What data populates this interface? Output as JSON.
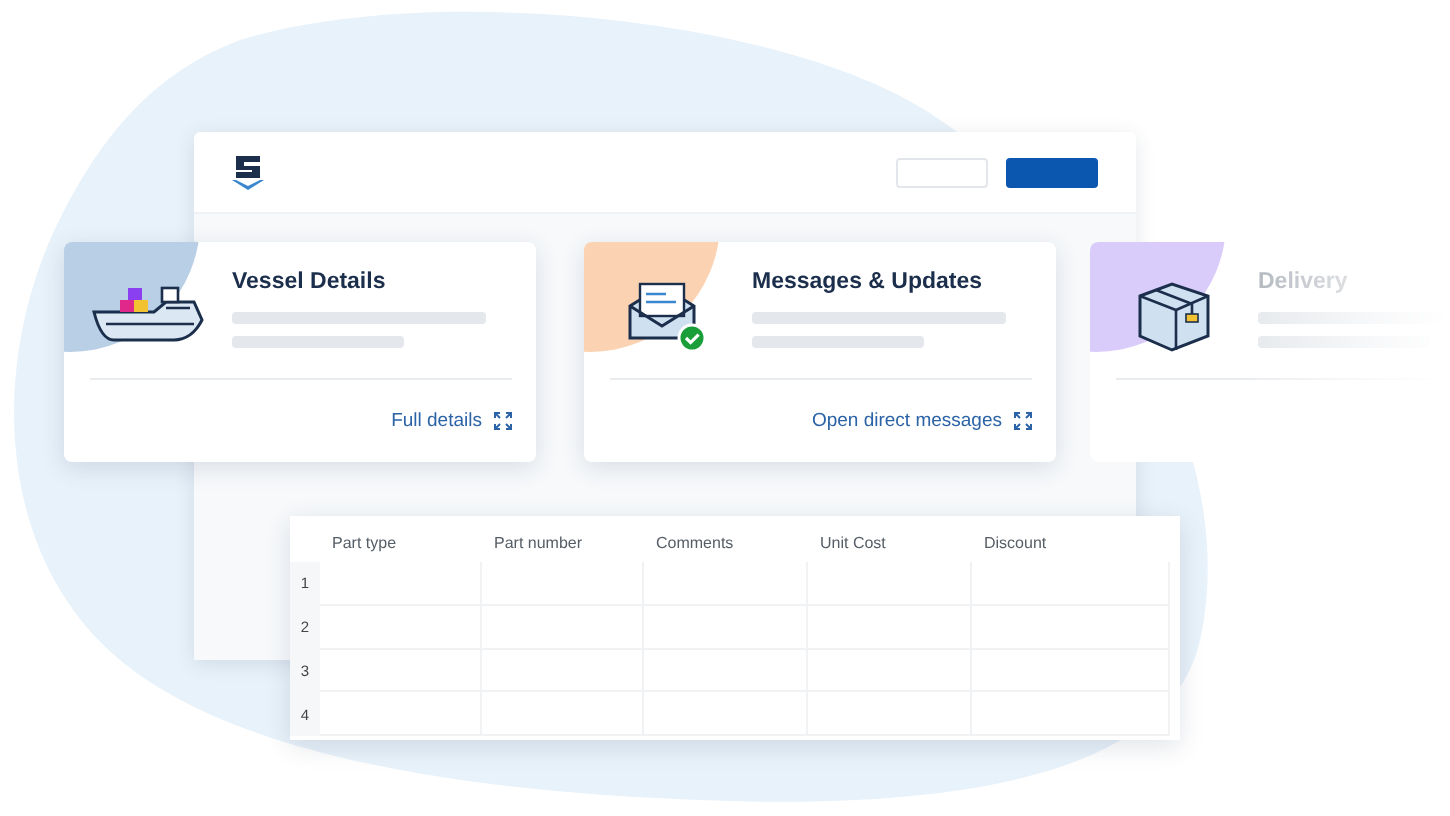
{
  "app_window": {
    "header_buttons": [
      {
        "kind": "outline"
      },
      {
        "kind": "primary"
      }
    ]
  },
  "cards": [
    {
      "kind": "ship",
      "title": "Vessel Details",
      "link": "Full details",
      "color": "#b9cfe6",
      "faded": false
    },
    {
      "kind": "envelope",
      "title": "Messages & Updates",
      "link": "Open direct messages",
      "color": "#fbd3b3",
      "faded": false
    },
    {
      "kind": "box",
      "title": "Delivery",
      "color": "#d9ccfb",
      "faded": true
    }
  ],
  "table": {
    "columns": [
      "Part type",
      "Part number",
      "Comments",
      "Unit Cost",
      "Discount"
    ],
    "rows": [
      "1",
      "2",
      "3",
      "4"
    ]
  }
}
